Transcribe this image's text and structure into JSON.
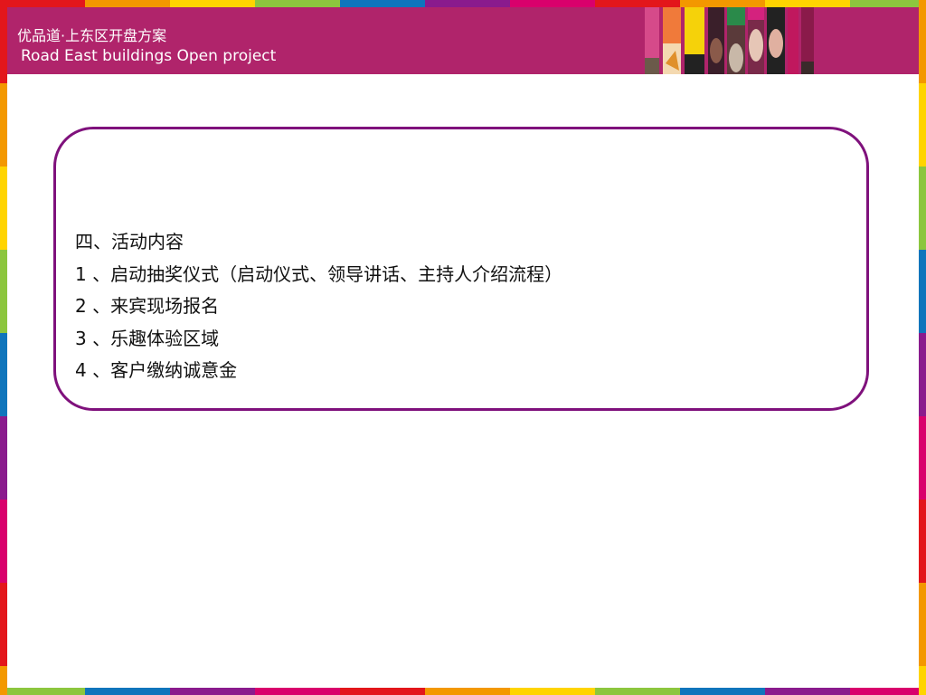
{
  "header": {
    "title": "优品道·上东区开盘方案",
    "subtitle": " Road East buildings Open project"
  },
  "content": {
    "heading": "四、活动内容",
    "items": [
      "1 、启动抽奖仪式（启动仪式、领导讲话、主持人介绍流程）",
      "2 、来宾现场报名",
      "3 、乐趣体验区域",
      "4 、客户缴纳诚意金"
    ]
  },
  "colors": {
    "header_bg": "#b0246b",
    "box_border": "#7f117c",
    "frame": [
      "#e3161b",
      "#f39800",
      "#ffd400",
      "#8cc63e",
      "#0f75bc",
      "#8a1b8d",
      "#d9006c"
    ]
  }
}
